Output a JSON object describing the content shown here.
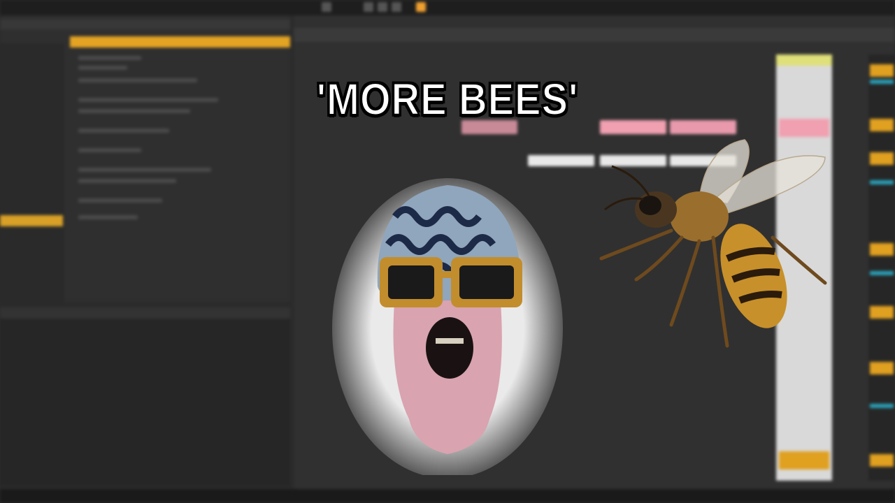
{
  "overlay": {
    "caption": "'MORE BEES'"
  },
  "figures": {
    "person": "person-in-pink-balaclava-and-cash-beanie",
    "bee": "honeybee-illustration"
  },
  "colors": {
    "accent": "#e4a423",
    "clip_pink": "#f0a0b0",
    "teal": "#2aa0b8",
    "background": "#2b2b2b"
  }
}
